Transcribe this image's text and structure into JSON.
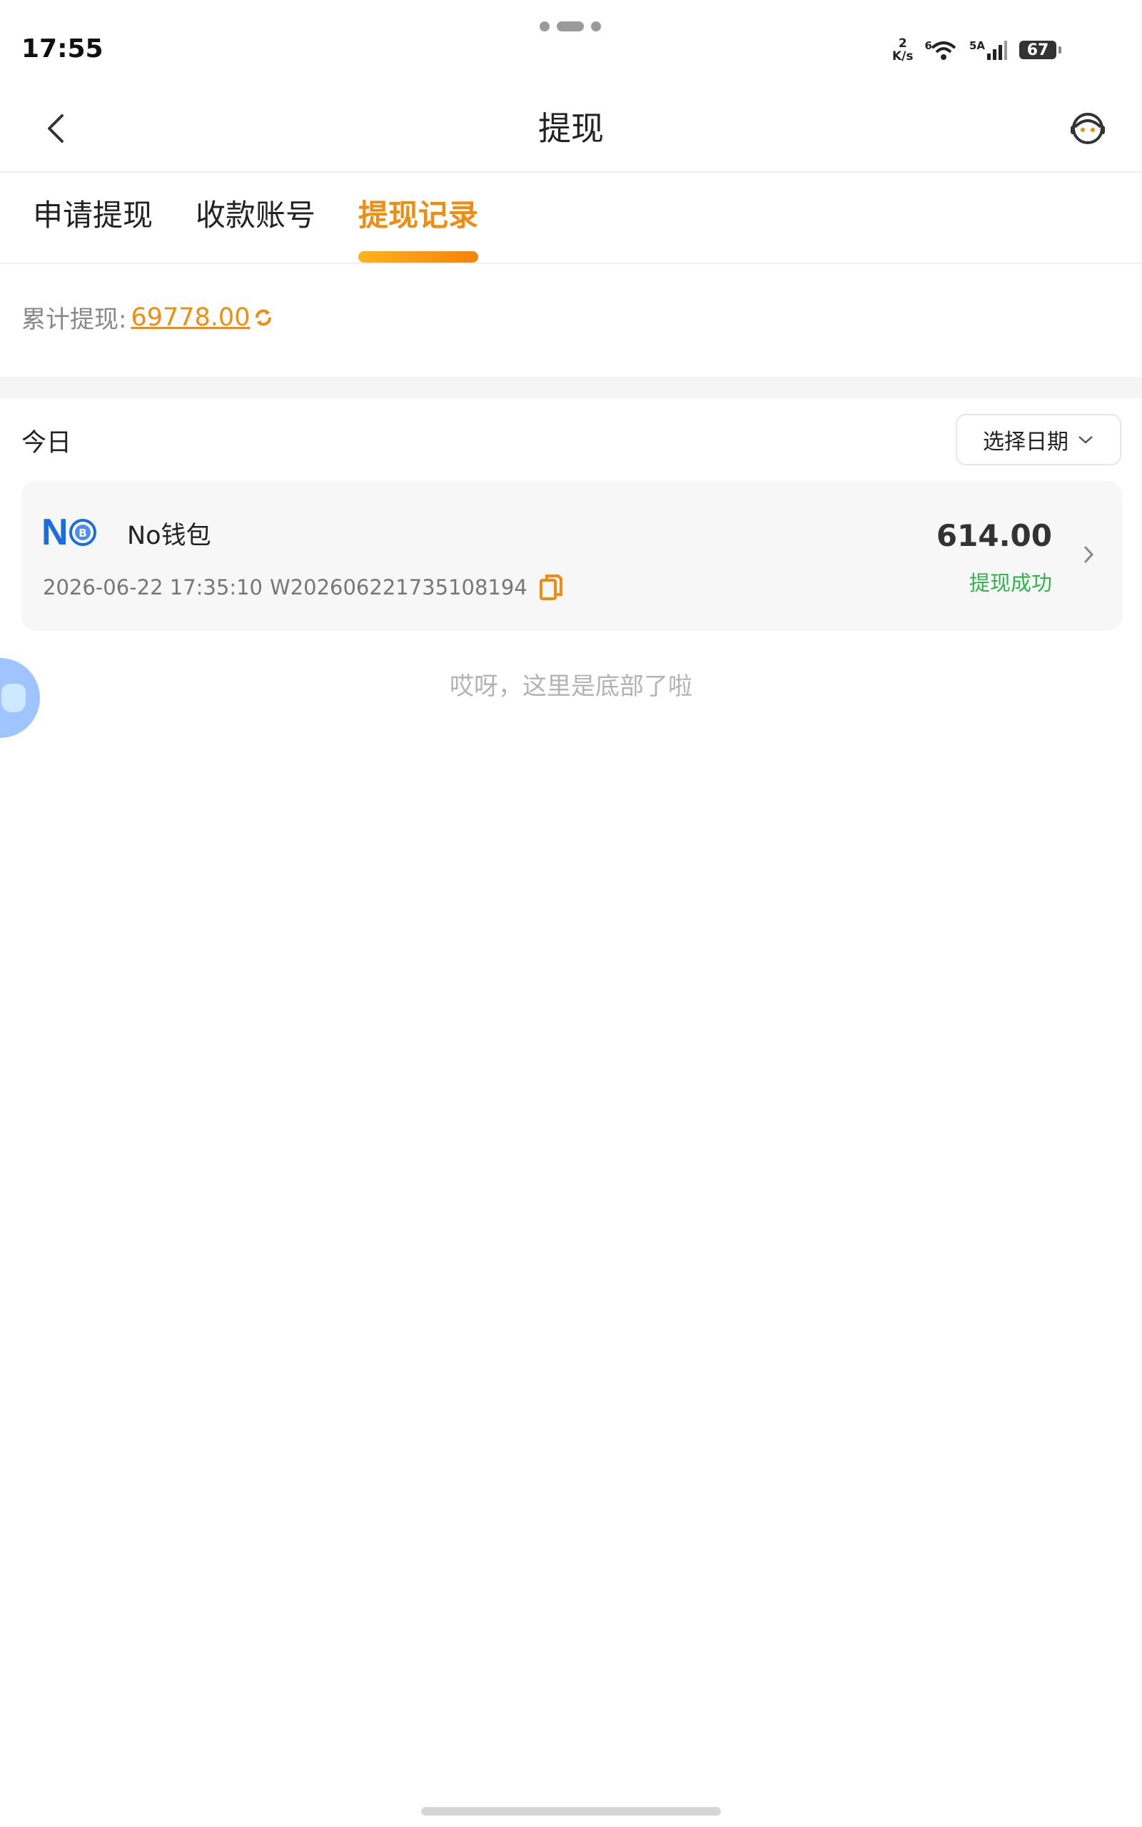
{
  "status_bar": {
    "time": "17:55",
    "net_speed_value": "2",
    "net_speed_unit": "K/s",
    "wifi_badge": "6",
    "signal_badge": "5A",
    "battery": "67",
    "icons": [
      "wifi-icon",
      "signal-icon",
      "battery-icon"
    ]
  },
  "header": {
    "title": "提现",
    "back_icon": "chevron-left-icon",
    "support_icon": "customer-service-icon"
  },
  "tabs": [
    {
      "label": "申请提现",
      "active": false
    },
    {
      "label": "收款账号",
      "active": false
    },
    {
      "label": "提现记录",
      "active": true
    }
  ],
  "summary": {
    "label": "累计提现:",
    "value": "69778.00",
    "icon": "refresh-icon"
  },
  "date_filter": {
    "today_label": "今日",
    "picker_label": "选择日期",
    "icon": "chevron-down-icon"
  },
  "records": [
    {
      "wallet_name": "No钱包",
      "datetime": "2026-06-22 17:35:10",
      "order_id": "W202606221735108194",
      "amount": "614.00",
      "status": "提现成功",
      "status_color": "#2fb34a"
    }
  ],
  "end_tip": "哎呀，这里是底部了啦",
  "colors": {
    "accent": "#f08c0f",
    "success": "#2fb34a",
    "logo_blue": "#1a6fe0"
  }
}
